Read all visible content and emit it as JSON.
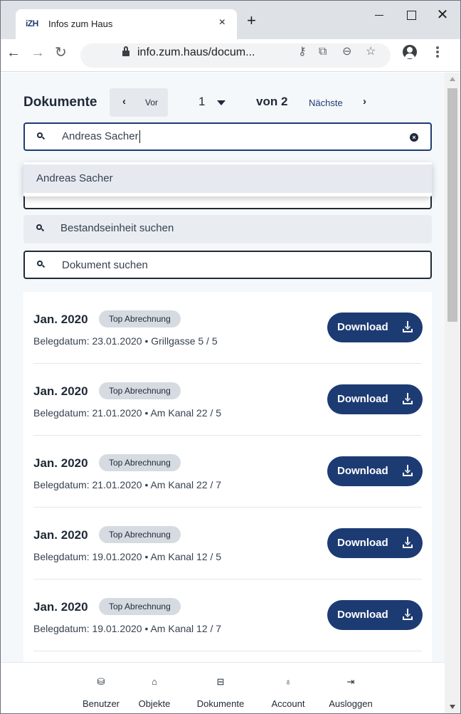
{
  "browser": {
    "tab_title": "Infos zum Haus",
    "favicon_text": "iZH",
    "tab_close": "×",
    "new_tab": "+",
    "url": "info.zum.haus/docum...",
    "window_close": "✕"
  },
  "header": {
    "title": "Dokumente",
    "prev_label": "Vor",
    "current_page": "1",
    "total_pages": "von 2",
    "next_label": "Nächste"
  },
  "search": {
    "person_value": "Andreas Sacher",
    "autocomplete_option": "Andreas Sacher",
    "unit_placeholder": "Bestandseinheit suchen",
    "document_placeholder": "Dokument suchen"
  },
  "documents": [
    {
      "title": "Jan. 2020",
      "badge": "Top Abrechnung",
      "meta": "Belegdatum: 23.01.2020 • Grillgasse 5 / 5",
      "button": "Download"
    },
    {
      "title": "Jan. 2020",
      "badge": "Top Abrechnung",
      "meta": "Belegdatum: 21.01.2020 • Am Kanal 22 / 5",
      "button": "Download"
    },
    {
      "title": "Jan. 2020",
      "badge": "Top Abrechnung",
      "meta": "Belegdatum: 21.01.2020 • Am Kanal 22 / 7",
      "button": "Download"
    },
    {
      "title": "Jan. 2020",
      "badge": "Top Abrechnung",
      "meta": "Belegdatum: 19.01.2020 • Am Kanal 12 / 5",
      "button": "Download"
    },
    {
      "title": "Jan. 2020",
      "badge": "Top Abrechnung",
      "meta": "Belegdatum: 19.01.2020 • Am Kanal 12 / 7",
      "button": "Download"
    }
  ],
  "bottom_nav": [
    {
      "label": "Benutzer",
      "icon": "database-icon"
    },
    {
      "label": "Objekte",
      "icon": "home-icon"
    },
    {
      "label": "Dokumente",
      "icon": "archive-icon"
    },
    {
      "label": "Account",
      "icon": "user-icon"
    },
    {
      "label": "Ausloggen",
      "icon": "logout-icon"
    }
  ],
  "colors": {
    "primary": "#1d3b73",
    "page_bg": "#f5f8fb",
    "badge_bg": "#d6dbe1"
  }
}
